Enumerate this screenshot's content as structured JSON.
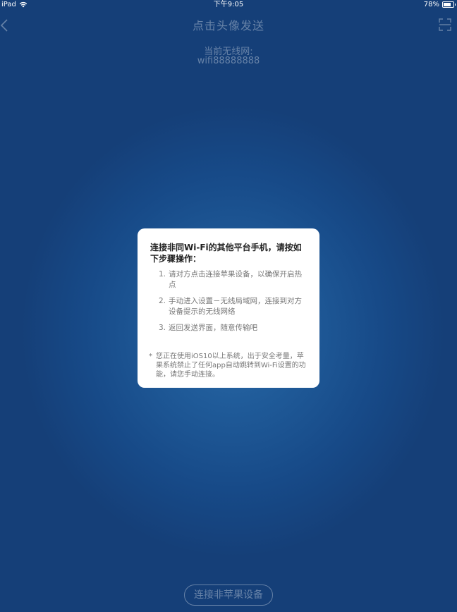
{
  "status_bar": {
    "device": "iPad",
    "time": "下午9:05",
    "battery": "78%",
    "battery_level": 0.78
  },
  "nav": {
    "title": "点击头像发送",
    "back_icon": "chevron-left-icon",
    "right_icon": "scan-icon"
  },
  "wifi": {
    "label": "当前无线网:",
    "name": "wifi88888888"
  },
  "dialog": {
    "title": "连接非同Wi-Fi的其他平台手机，请按如下步骤操作：",
    "steps": [
      {
        "num": "1.",
        "text": "请对方点击连接苹果设备，以确保开启热点"
      },
      {
        "num": "2.",
        "text": "手动进入设置－无线局域网，连接到对方设备提示的无线网络"
      },
      {
        "num": "3.",
        "text": "返回发送界面，随意传输吧"
      }
    ],
    "note_mark": "*",
    "note": "您正在使用iOS10以上系统，出于安全考量，苹果系统禁止了任何app自动跳转到Wi-Fi设置的功能，请您手动连接。"
  },
  "bottom_button": {
    "label": "连接非苹果设备"
  },
  "colors": {
    "background": "#174a88",
    "dialog": "#ffffff",
    "title_text": "#222222",
    "body_text": "#777777"
  }
}
